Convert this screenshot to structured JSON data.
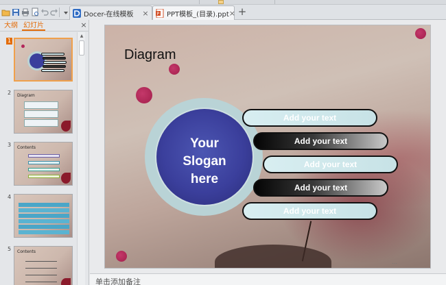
{
  "colors": {
    "accent": "#e36c09",
    "slogan_circle": "#3b3f9c",
    "ring": "#b9d3d6",
    "dot": "#b3275a"
  },
  "quick_access": {
    "icons": [
      "open-folder-icon",
      "save-icon",
      "print-icon",
      "print-preview-icon",
      "undo-icon",
      "redo-icon",
      "customize-icon"
    ]
  },
  "tabs": [
    {
      "label": "Docer-在线模板",
      "icon": "docer-icon"
    },
    {
      "label": "PPT模板_(目录).ppt",
      "icon": "ppt-file-icon"
    }
  ],
  "new_tab_label": "+",
  "close_glyph": "×",
  "panel": {
    "tab_outline": "大纲",
    "tab_slides": "幻灯片",
    "thumbnails": [
      {
        "number": "1",
        "title": ""
      },
      {
        "number": "2",
        "title": "Diagram"
      },
      {
        "number": "3",
        "title": "Contents"
      },
      {
        "number": "4",
        "title": ""
      },
      {
        "number": "5",
        "title": "Contents"
      }
    ]
  },
  "slide": {
    "title": "Diagram",
    "slogan": [
      "Your",
      "Slogan",
      "here"
    ],
    "bars": [
      "Add your text",
      "Add your text",
      "Add your text",
      "Add your text",
      "Add your text"
    ]
  },
  "notes_placeholder": "单击添加备注"
}
